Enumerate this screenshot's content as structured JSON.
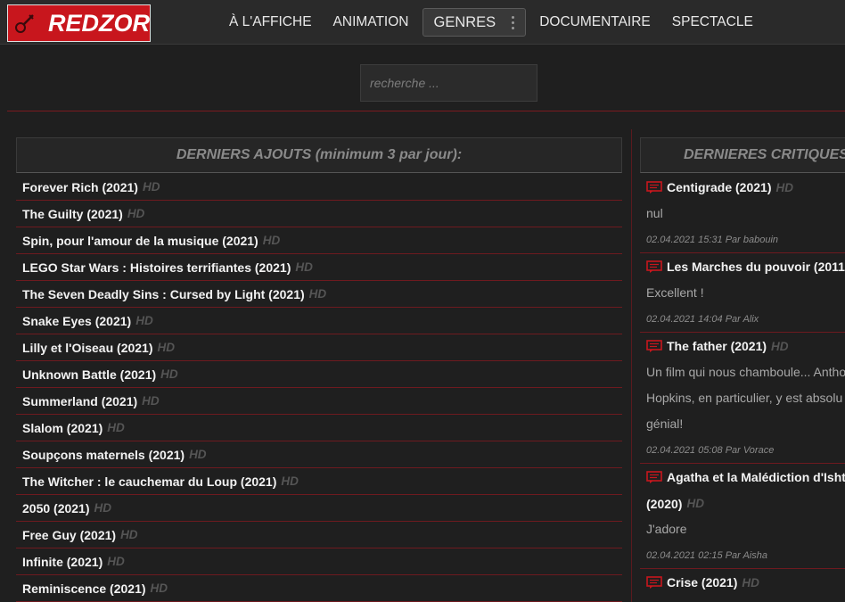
{
  "header": {
    "logo_text": "REDZOR",
    "nav": [
      {
        "label": "À L'AFFICHE"
      },
      {
        "label": "ANIMATION"
      },
      {
        "label": "GENRES"
      },
      {
        "label": "DOCUMENTAIRE"
      },
      {
        "label": "SPECTACLE"
      }
    ]
  },
  "search": {
    "placeholder": "recherche ..."
  },
  "latest": {
    "title": "DERNIERS AJOUTS (minimum 3 par jour):",
    "hd_label": "HD",
    "items": [
      {
        "title": "Forever Rich (2021)"
      },
      {
        "title": "The Guilty (2021)"
      },
      {
        "title": "Spin, pour l'amour de la musique (2021)"
      },
      {
        "title": "LEGO Star Wars : Histoires terrifiantes (2021)"
      },
      {
        "title": "The Seven Deadly Sins : Cursed by Light (2021)"
      },
      {
        "title": "Snake Eyes (2021)"
      },
      {
        "title": "Lilly et l'Oiseau (2021)"
      },
      {
        "title": "Unknown Battle (2021)"
      },
      {
        "title": "Summerland (2021)"
      },
      {
        "title": "Slalom (2021)"
      },
      {
        "title": "Soupçons maternels (2021)"
      },
      {
        "title": "The Witcher : le cauchemar du Loup (2021)"
      },
      {
        "title": "2050 (2021)"
      },
      {
        "title": "Free Guy (2021)"
      },
      {
        "title": "Infinite (2021)"
      },
      {
        "title": "Reminiscence (2021)"
      }
    ]
  },
  "critiques": {
    "title": "DERNIERES CRITIQUES",
    "hd_label": "HD",
    "items": [
      {
        "title": "Centigrade (2021)",
        "text": "nul",
        "meta": "02.04.2021 15:31 Par babouin"
      },
      {
        "title": "Les Marches du pouvoir (2011",
        "text": "Excellent !",
        "meta": "02.04.2021 14:04 Par Alix"
      },
      {
        "title": "The father (2021)",
        "text1": "Un film qui nous chamboule... Antho",
        "text2": "Hopkins, en particulier, y est absolu",
        "text3": "génial!",
        "meta": "02.04.2021 05:08 Par Vorace"
      },
      {
        "title": "Agatha et la Malédiction d'Isht",
        "title2": "(2020)",
        "text": "J'adore",
        "meta": "02.04.2021 02:15 Par Aisha"
      },
      {
        "title": "Crise (2021)"
      }
    ]
  },
  "colors": {
    "accent": "#c8161d",
    "background": "#1f1f1f",
    "divider": "#6e1a1f"
  }
}
